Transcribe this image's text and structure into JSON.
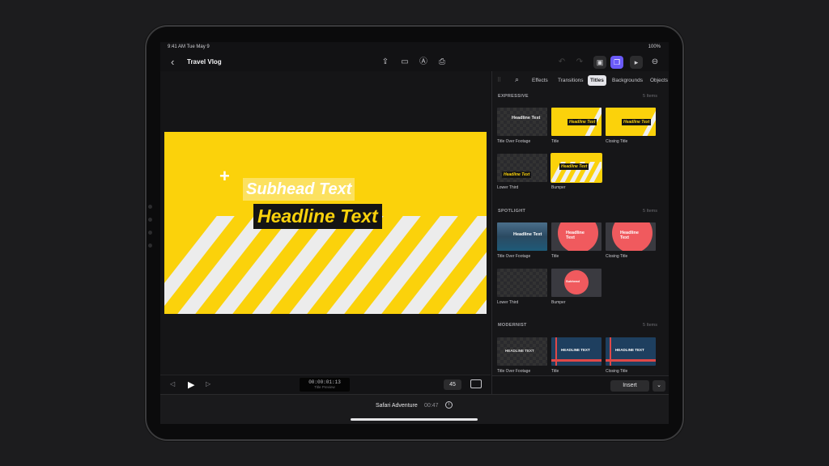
{
  "status": {
    "time": "9:41 AM  Tue May 9",
    "battery": "100%"
  },
  "header": {
    "back_icon": "chevron-left-icon",
    "title": "Travel Vlog",
    "icons": [
      "share-icon",
      "camera-icon",
      "voiceover-icon",
      "export-icon"
    ],
    "right_icons": [
      "undo-icon",
      "redo-icon",
      "photo-icon",
      "browser-icon",
      "play-icon",
      "more-icon"
    ]
  },
  "viewer": {
    "subhead": "Subhead Text",
    "headline": "Headline Text",
    "colors": {
      "background": "#fbd20b",
      "stripe": "#ececec",
      "headline_bg": "#141414"
    }
  },
  "transport": {
    "timecode": "00:00:01:13",
    "timecode_label": "Title Preview",
    "zoom": "45"
  },
  "panel": {
    "tabs": [
      {
        "label": "Effects"
      },
      {
        "label": "Transitions"
      },
      {
        "label": "Titles",
        "active": true
      },
      {
        "label": "Backgrounds"
      },
      {
        "label": "Objects"
      }
    ],
    "sections": [
      {
        "name": "EXPRESSIVE",
        "count": "5 Items",
        "items": [
          "Title Over Footage",
          "Title",
          "Closing Title",
          "Lower Third",
          "Bumper"
        ]
      },
      {
        "name": "SPOTLIGHT",
        "count": "5 Items",
        "items": [
          "Title Over Footage",
          "Title",
          "Closing Title",
          "Lower Third",
          "Bumper"
        ]
      },
      {
        "name": "MODERNIST",
        "count": "5 Items",
        "items": [
          "Title Over Footage",
          "Title",
          "Closing Title"
        ]
      }
    ],
    "thumb_text": {
      "headline": "Headline Text",
      "headline_upper": "HEADLINE TEXT",
      "spot_title": "Headline Text",
      "spot_sub": "Subhead"
    },
    "insert_label": "Insert",
    "more_label": "⌄"
  },
  "timeline": {
    "project_name": "Safari Adventure",
    "duration": "00:47",
    "info": "i"
  }
}
